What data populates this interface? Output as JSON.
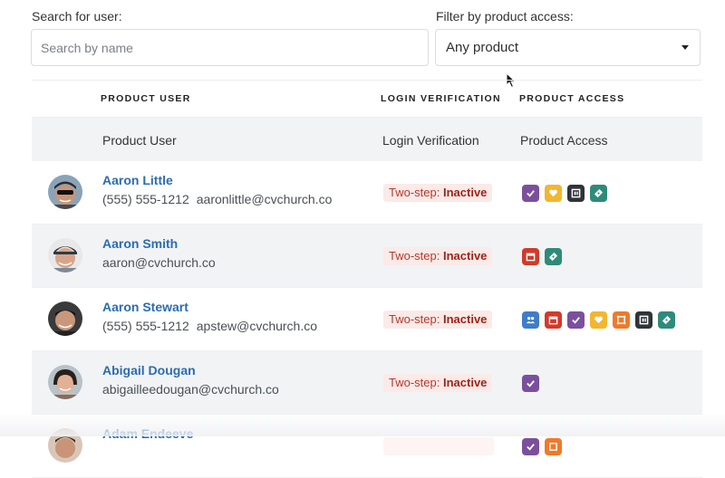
{
  "search": {
    "label": "Search for user:",
    "placeholder": "Search by name"
  },
  "filter": {
    "label": "Filter by product access:",
    "value": "Any product"
  },
  "table": {
    "headers": {
      "user": "PRODUCT USER",
      "login": "LOGIN VERIFICATION",
      "access": "PRODUCT ACCESS"
    },
    "subheaders": {
      "user": "Product User",
      "login": "Login Verification",
      "access": "Product Access"
    },
    "badge_prefix": "Two-step:",
    "rows": [
      {
        "name": "Aaron Little",
        "phone": "(555) 555-1212",
        "email": "aaronlittle@cvchurch.co",
        "status": "Inactive"
      },
      {
        "name": "Aaron Smith",
        "phone": "",
        "email": "aaron@cvchurch.co",
        "status": "Inactive"
      },
      {
        "name": "Aaron Stewart",
        "phone": "(555) 555-1212",
        "email": "apstew@cvchurch.co",
        "status": "Inactive"
      },
      {
        "name": "Abigail Dougan",
        "phone": "",
        "email": "abigailleedougan@cvchurch.co",
        "status": "Inactive"
      },
      {
        "name": "Adam Endeeve",
        "phone": "",
        "email": "",
        "status": ""
      }
    ]
  },
  "product_icons": {
    "check-ins": {
      "color": "#7b4f9d",
      "icon": "check-icon"
    },
    "giving": {
      "color": "#f2b631",
      "icon": "heart-icon"
    },
    "publishing": {
      "color": "#2f3439",
      "icon": "publishing-icon"
    },
    "registrations": {
      "color": "#2e8b7a",
      "icon": "ticket-icon"
    },
    "calendar": {
      "color": "#d23a2a",
      "icon": "calendar-icon"
    },
    "people": {
      "color": "#3f7dc9",
      "icon": "people-icon"
    },
    "groups": {
      "color": "#ef7a2a",
      "icon": "groups-icon"
    }
  }
}
